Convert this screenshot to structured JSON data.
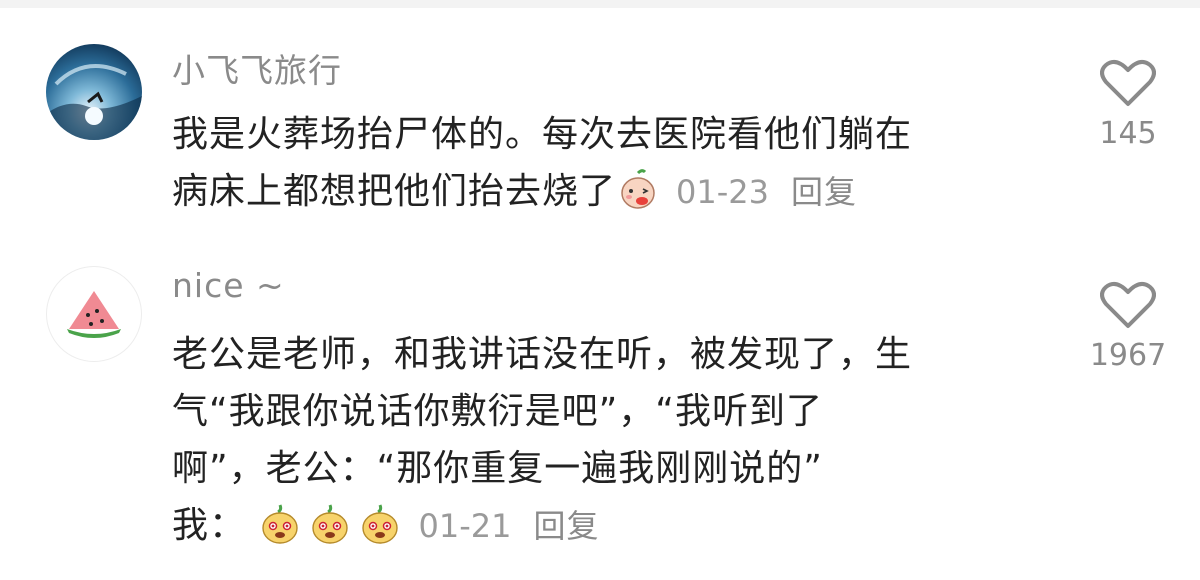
{
  "comments": [
    {
      "username": "小飞飞旅行",
      "text_lines": [
        "我是火葬场抬尸体的。每次去医院看他们躺在",
        "病床上都想把他们抬去烧了"
      ],
      "emojis": [
        "blushing-face-emoji"
      ],
      "date": "01-23",
      "reply_label": "回复",
      "likes": "145",
      "avatar_icon": "ocean-wave-avatar"
    },
    {
      "username": "nice ~",
      "text_lines": [
        "老公是老师，和我讲话没在听，被发现了，生",
        "气“我跟你说话你敷衍是吧”，“我听到了",
        "啊”，老公：“那你重复一遍我刚刚说的”",
        "我："
      ],
      "emojis": [
        "chick-face-emoji",
        "chick-face-emoji",
        "chick-face-emoji"
      ],
      "date": "01-21",
      "reply_label": "回复",
      "likes": "1967",
      "avatar_icon": "watermelon-avatar"
    }
  ],
  "colors": {
    "username": "#8a8a8a",
    "text": "#222222",
    "meta": "#9a9a9a"
  }
}
